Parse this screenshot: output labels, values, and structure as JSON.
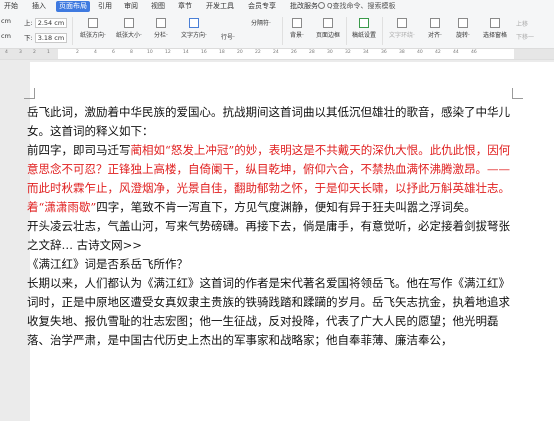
{
  "tabs": [
    "开始",
    "插入",
    "页面布局",
    "引用",
    "审阅",
    "视图",
    "章节",
    "开发工具",
    "会员专享",
    "批改服务"
  ],
  "search": "Q查找命令、搜索模板",
  "toolbar": {
    "cm1": "cm",
    "cm2": "cm",
    "top_label": "上:",
    "top_val": "2.54 cm",
    "bottom_label": "下:",
    "bottom_val": "3.18 cm",
    "orientation": "纸张方向·",
    "size": "纸张大小·",
    "columns": "分栏·",
    "text_direction": "文字方向·",
    "line_numbers": "行号·",
    "separator": "分隔符·",
    "background": "背景·",
    "page_border": "页面边框",
    "draft_settings": "稿纸设置",
    "wrap_text": "文字环绕·",
    "align": "对齐·",
    "rotate": "旋转·",
    "select_pane": "选择窗格",
    "up_layer": "上移",
    "down_layer": "下移一"
  },
  "ruler": [
    "4",
    "3",
    "2",
    "1",
    "2",
    "4",
    "6",
    "8",
    "10",
    "12",
    "14",
    "16",
    "18",
    "20",
    "22",
    "24",
    "26",
    "28",
    "30",
    "32",
    "34",
    "36",
    "38",
    "40",
    "42",
    "44",
    "46"
  ],
  "doc": {
    "p1": "岳飞此词，激励着中华民族的爱国心。抗战期间这首词曲以其低沉但雄壮的歌音，感染了中华儿女。这首词的释义如下：",
    "p2_a": "前四字，即司马迁写",
    "p2_red1": "蔺相如“怒发上冲冠”的妙，表明这是不共戴天的深仇大恨。此仇此恨，因何意思念不可忍？正锋独上高楼，自倚阑干，纵目乾坤，俯仰六合，不禁热血满怀沸腾激昂。——而此时秋霖乍止，风澄烟净，光景自佳，翻助郁勃之怀，于是仰天长啸，以抒此万斛英雄壮志。着“潇潇雨歇”",
    "p2_b": "四字，笔致不肯一泻直下，方见气度渊静，便知有异于狂夫叫嚣之浮词矣。",
    "p3": "开头凌云壮志，气盖山河，写来气势磅礴。再接下去，倘是庸手，有意觉听，必定接着剑拔弩张之文辞… 古诗文网>>",
    "p4": "《满江红》词是否系岳飞所作？",
    "p5": "长期以来，人们都认为《满江红》这首词的作者是宋代著名爱国将领岳飞。他在写作《满江红》词时，正是中原地区遭受女真奴隶主贵族的铁骑践踏和蹂躏的岁月。岳飞矢志抗金，执着地追求收复失地、报仇雪耻的壮志宏图；他一生征战，反对投降，代表了广大人民的愿望；他光明磊落、治学严肃，是中国古代历史上杰出的军事家和战略家；他自奉菲薄、廉洁奉公，"
  }
}
